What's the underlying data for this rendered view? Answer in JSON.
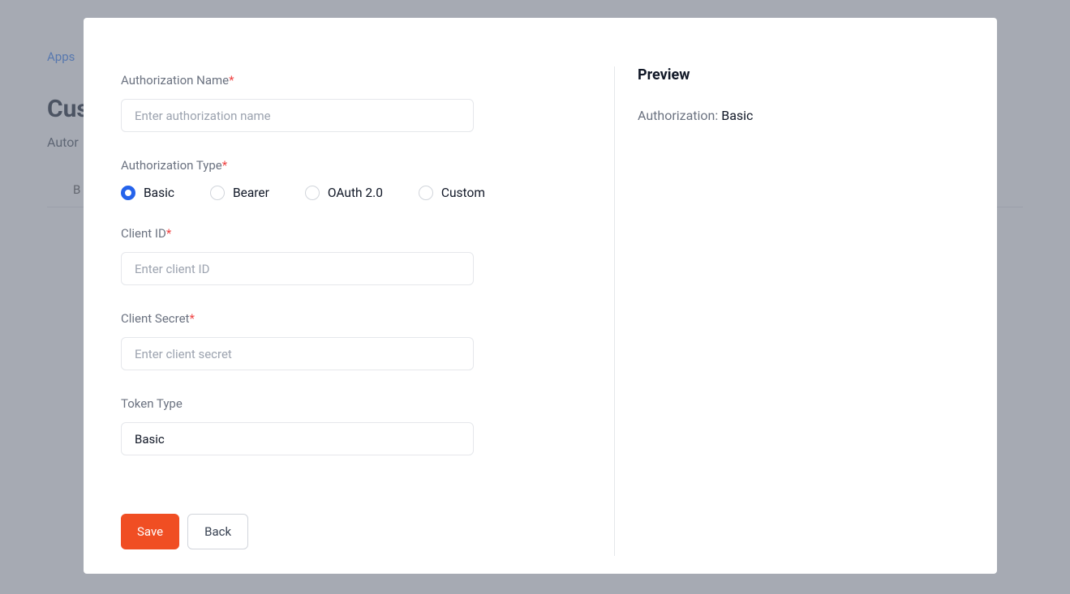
{
  "background": {
    "breadcrumb": "Apps",
    "title_partial": "Cus",
    "subtitle_partial": "Autor",
    "tab_partial": "B"
  },
  "form": {
    "auth_name": {
      "label": "Authorization Name",
      "required": "*",
      "placeholder": "Enter authorization name",
      "value": ""
    },
    "auth_type": {
      "label": "Authorization Type",
      "required": "*",
      "options": [
        "Basic",
        "Bearer",
        "OAuth 2.0",
        "Custom"
      ],
      "selected": "Basic"
    },
    "client_id": {
      "label": "Client ID",
      "required": "*",
      "placeholder": "Enter client ID",
      "value": ""
    },
    "client_secret": {
      "label": "Client Secret",
      "required": "*",
      "placeholder": "Enter client secret",
      "value": ""
    },
    "token_type": {
      "label": "Token Type",
      "value": "Basic"
    },
    "buttons": {
      "save": "Save",
      "back": "Back"
    }
  },
  "preview": {
    "title": "Preview",
    "auth_key": "Authorization: ",
    "auth_value": "Basic"
  }
}
